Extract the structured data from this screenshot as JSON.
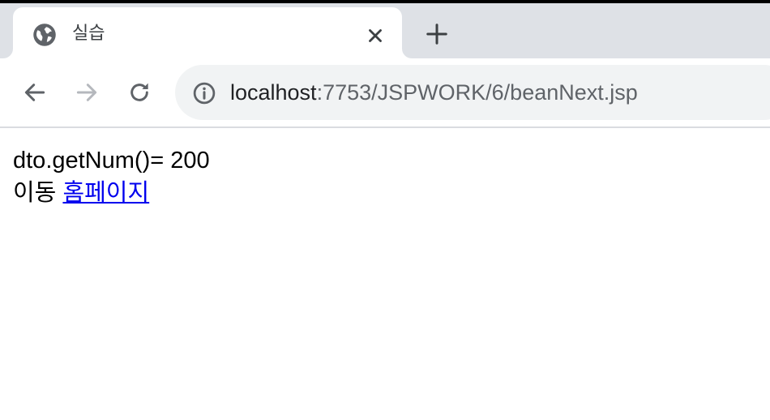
{
  "browser": {
    "tab": {
      "title": "실습",
      "favicon": "globe-icon"
    },
    "address": {
      "host": "localhost",
      "path": ":7753/JSPWORK/6/beanNext.jsp"
    }
  },
  "page": {
    "line1": "dto.getNum()= 200",
    "line2_prefix": "이동",
    "link_text": "홈페이지"
  },
  "colors": {
    "tab_strip": "#dee1e6",
    "omnibox": "#f1f3f4",
    "link": "#0000ee",
    "icon": "#5f6368"
  }
}
